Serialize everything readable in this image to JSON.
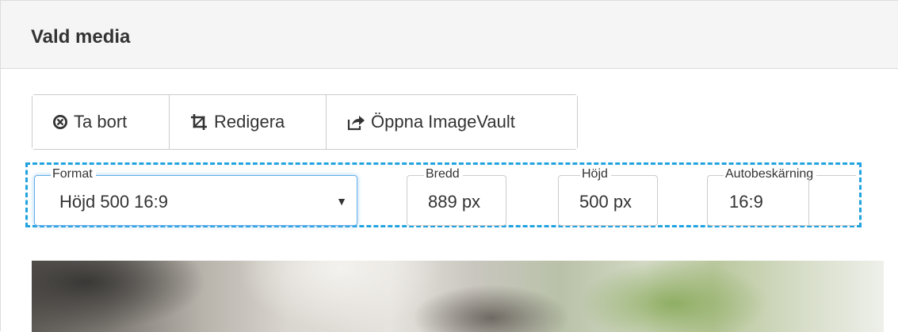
{
  "panel": {
    "title": "Vald media"
  },
  "toolbar": {
    "remove_label": "Ta bort",
    "edit_label": "Redigera",
    "open_label": "Öppna ImageVault"
  },
  "fields": {
    "format": {
      "legend": "Format",
      "value": "Höjd 500 16:9"
    },
    "width": {
      "legend": "Bredd",
      "value": "889 px"
    },
    "height": {
      "legend": "Höjd",
      "value": "500 px"
    },
    "autocrop": {
      "legend": "Autobeskärning",
      "value": "16:9"
    }
  },
  "colors": {
    "accent_dashed": "#22a3e0",
    "focus_border": "#66afe9"
  },
  "icons": {
    "remove": "times-circle-icon",
    "edit": "crop-icon",
    "open": "share-icon",
    "select": "caret-down-icon"
  }
}
